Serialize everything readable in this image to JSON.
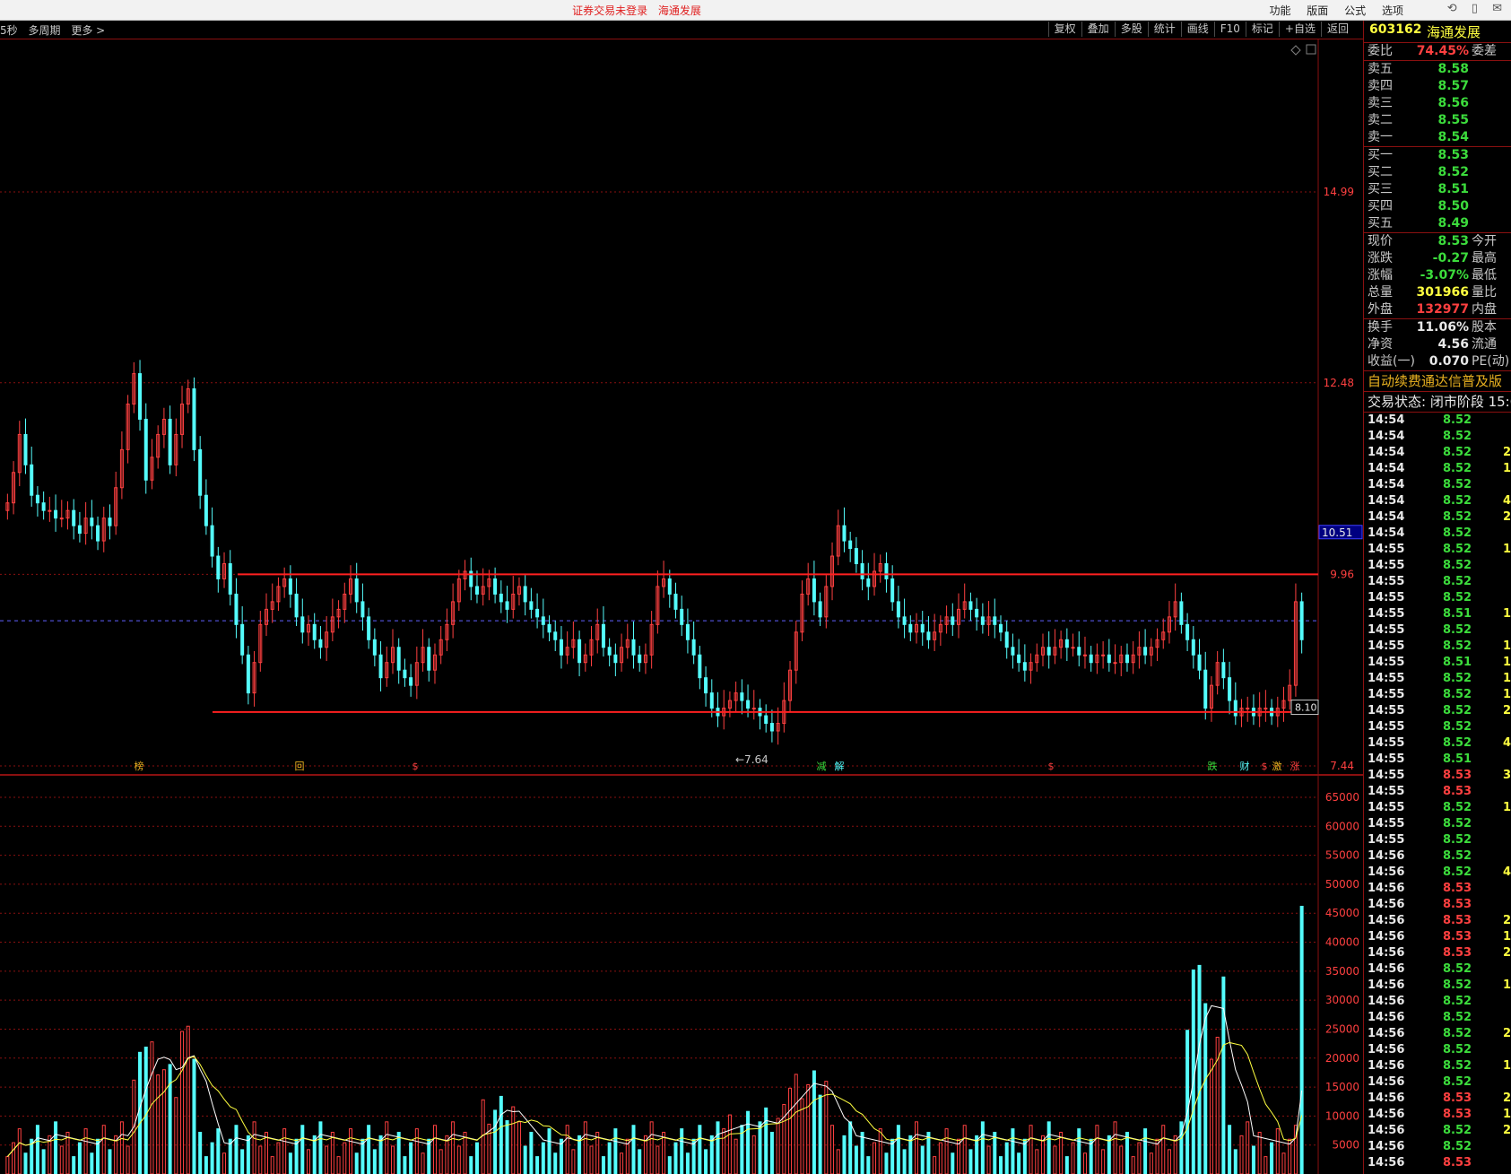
{
  "titlebar": {
    "center": [
      "证券交易未登录",
      "海通发展"
    ],
    "menu": [
      "功能",
      "版面",
      "公式",
      "选项"
    ],
    "controls": [
      "⟲",
      "▯",
      "✉"
    ]
  },
  "toolbar": {
    "left": [
      "5秒",
      "多周期",
      "更多 >"
    ],
    "right": [
      "复权",
      "叠加",
      "多股",
      "统计",
      "画线",
      "F10",
      "标记",
      "+自选",
      "返回"
    ]
  },
  "price_axis": {
    "labels": [
      "14.99",
      "12.48",
      "10.51",
      "9.96",
      "7.44"
    ],
    "current_marker": "10.51",
    "low_label": "←7.64",
    "last_label": "8.10"
  },
  "volume_axis": {
    "labels": [
      "65000",
      "60000",
      "55000",
      "50000",
      "45000",
      "40000",
      "35000",
      "30000",
      "25000",
      "20000",
      "15000",
      "10000",
      "5000"
    ]
  },
  "events": [
    "榜",
    "回",
    "$",
    "减",
    "解",
    "$",
    "跌",
    "财",
    "$",
    "激",
    "涨"
  ],
  "colors": {
    "up": "#ff4040",
    "down": "#54fcfc",
    "grid": "#8a1010",
    "level_line": "#ff2020",
    "ma": "#ffffff",
    "ma2": "#ffff40"
  },
  "quote": {
    "code": "603162",
    "name": "海通发展",
    "weibi": {
      "label": "委比",
      "value": "74.45%",
      "label2": "委差"
    },
    "sells": [
      {
        "label": "卖五",
        "price": "8.58"
      },
      {
        "label": "卖四",
        "price": "8.57"
      },
      {
        "label": "卖三",
        "price": "8.56"
      },
      {
        "label": "卖二",
        "price": "8.55"
      },
      {
        "label": "卖一",
        "price": "8.54"
      }
    ],
    "buys": [
      {
        "label": "买一",
        "price": "8.53"
      },
      {
        "label": "买二",
        "price": "8.52"
      },
      {
        "label": "买三",
        "price": "8.51"
      },
      {
        "label": "买四",
        "price": "8.50"
      },
      {
        "label": "买五",
        "price": "8.49"
      }
    ],
    "stats": [
      {
        "label": "现价",
        "value": "8.53",
        "label2": "今开",
        "color": "green"
      },
      {
        "label": "涨跌",
        "value": "-0.27",
        "label2": "最高",
        "color": "green"
      },
      {
        "label": "涨幅",
        "value": "-3.07%",
        "label2": "最低",
        "color": "green"
      },
      {
        "label": "总量",
        "value": "301966",
        "label2": "量比",
        "color": "yellow"
      },
      {
        "label": "外盘",
        "value": "132977",
        "label2": "内盘",
        "color": "red"
      }
    ],
    "stats2": [
      {
        "label": "换手",
        "value": "11.06%",
        "label2": "股本",
        "color": "white"
      },
      {
        "label": "净资",
        "value": "4.56",
        "label2": "流通",
        "color": "white"
      },
      {
        "label": "收益(一)",
        "value": "0.070",
        "label2": "PE(动)",
        "color": "white"
      }
    ],
    "banner": "自动续费通达信普及版",
    "status": "交易状态: 闭市阶段 15:0"
  },
  "ticks": [
    {
      "time": "14:54",
      "price": "8.52",
      "vol": ""
    },
    {
      "time": "14:54",
      "price": "8.52",
      "vol": ""
    },
    {
      "time": "14:54",
      "price": "8.52",
      "vol": "2"
    },
    {
      "time": "14:54",
      "price": "8.52",
      "vol": "1"
    },
    {
      "time": "14:54",
      "price": "8.52",
      "vol": ""
    },
    {
      "time": "14:54",
      "price": "8.52",
      "vol": "4"
    },
    {
      "time": "14:54",
      "price": "8.52",
      "vol": "2"
    },
    {
      "time": "14:54",
      "price": "8.52",
      "vol": ""
    },
    {
      "time": "14:55",
      "price": "8.52",
      "vol": "1"
    },
    {
      "time": "14:55",
      "price": "8.52",
      "vol": ""
    },
    {
      "time": "14:55",
      "price": "8.52",
      "vol": ""
    },
    {
      "time": "14:55",
      "price": "8.52",
      "vol": ""
    },
    {
      "time": "14:55",
      "price": "8.51",
      "vol": "1"
    },
    {
      "time": "14:55",
      "price": "8.52",
      "vol": ""
    },
    {
      "time": "14:55",
      "price": "8.52",
      "vol": "1"
    },
    {
      "time": "14:55",
      "price": "8.51",
      "vol": "1"
    },
    {
      "time": "14:55",
      "price": "8.52",
      "vol": "1"
    },
    {
      "time": "14:55",
      "price": "8.52",
      "vol": "1"
    },
    {
      "time": "14:55",
      "price": "8.52",
      "vol": "2"
    },
    {
      "time": "14:55",
      "price": "8.52",
      "vol": ""
    },
    {
      "time": "14:55",
      "price": "8.52",
      "vol": "4"
    },
    {
      "time": "14:55",
      "price": "8.51",
      "vol": ""
    },
    {
      "time": "14:55",
      "price": "8.53",
      "vol": "3"
    },
    {
      "time": "14:55",
      "price": "8.53",
      "vol": ""
    },
    {
      "time": "14:55",
      "price": "8.52",
      "vol": "1"
    },
    {
      "time": "14:55",
      "price": "8.52",
      "vol": ""
    },
    {
      "time": "14:55",
      "price": "8.52",
      "vol": ""
    },
    {
      "time": "14:56",
      "price": "8.52",
      "vol": ""
    },
    {
      "time": "14:56",
      "price": "8.52",
      "vol": "4"
    },
    {
      "time": "14:56",
      "price": "8.53",
      "vol": ""
    },
    {
      "time": "14:56",
      "price": "8.53",
      "vol": ""
    },
    {
      "time": "14:56",
      "price": "8.53",
      "vol": "2"
    },
    {
      "time": "14:56",
      "price": "8.53",
      "vol": "1"
    },
    {
      "time": "14:56",
      "price": "8.53",
      "vol": "2"
    },
    {
      "time": "14:56",
      "price": "8.52",
      "vol": ""
    },
    {
      "time": "14:56",
      "price": "8.52",
      "vol": "1"
    },
    {
      "time": "14:56",
      "price": "8.52",
      "vol": ""
    },
    {
      "time": "14:56",
      "price": "8.52",
      "vol": ""
    },
    {
      "time": "14:56",
      "price": "8.52",
      "vol": "2"
    },
    {
      "time": "14:56",
      "price": "8.52",
      "vol": ""
    },
    {
      "time": "14:56",
      "price": "8.52",
      "vol": "1"
    },
    {
      "time": "14:56",
      "price": "8.52",
      "vol": ""
    },
    {
      "time": "14:56",
      "price": "8.53",
      "vol": "2"
    },
    {
      "time": "14:56",
      "price": "8.53",
      "vol": "1"
    },
    {
      "time": "14:56",
      "price": "8.52",
      "vol": "2"
    },
    {
      "time": "14:56",
      "price": "8.52",
      "vol": ""
    },
    {
      "time": "14:56",
      "price": "8.53",
      "vol": ""
    }
  ],
  "chart_data": {
    "type": "candlestick",
    "price_ylim": [
      7.44,
      14.99
    ],
    "price_ticks": [
      7.44,
      9.96,
      12.48,
      14.99
    ],
    "support": 8.15,
    "resistance": 9.96,
    "low_marker": 7.64,
    "closes": [
      10.9,
      11.3,
      11.8,
      11.4,
      11.0,
      10.9,
      10.8,
      10.8,
      10.7,
      10.7,
      10.8,
      10.6,
      10.5,
      10.7,
      10.6,
      10.4,
      10.7,
      10.6,
      11.1,
      11.6,
      12.2,
      12.6,
      12.0,
      11.2,
      11.5,
      11.8,
      12.0,
      11.4,
      11.8,
      12.2,
      12.4,
      11.6,
      11.0,
      10.6,
      10.2,
      9.9,
      10.1,
      9.7,
      9.3,
      8.9,
      8.4,
      8.8,
      9.3,
      9.5,
      9.6,
      9.8,
      9.9,
      9.7,
      9.4,
      9.2,
      9.3,
      9.1,
      9.0,
      9.2,
      9.4,
      9.5,
      9.7,
      9.9,
      9.6,
      9.4,
      9.1,
      8.9,
      8.6,
      8.8,
      9.0,
      8.7,
      8.6,
      8.5,
      8.8,
      9.0,
      8.7,
      8.9,
      9.1,
      9.3,
      9.6,
      9.9,
      10.0,
      9.8,
      9.7,
      9.8,
      9.9,
      9.7,
      9.6,
      9.5,
      9.7,
      9.8,
      9.6,
      9.5,
      9.4,
      9.3,
      9.2,
      9.1,
      8.9,
      9.0,
      9.1,
      8.8,
      8.9,
      9.1,
      9.3,
      9.0,
      8.9,
      8.8,
      9.0,
      9.1,
      8.9,
      8.8,
      8.9,
      9.3,
      9.8,
      9.9,
      9.7,
      9.5,
      9.3,
      9.1,
      8.9,
      8.6,
      8.4,
      8.2,
      8.1,
      8.2,
      8.3,
      8.4,
      8.3,
      8.2,
      8.2,
      8.1,
      8.0,
      7.9,
      8.0,
      8.3,
      8.7,
      9.2,
      9.7,
      9.9,
      9.6,
      9.4,
      9.8,
      10.2,
      10.6,
      10.4,
      10.3,
      10.1,
      9.9,
      9.8,
      10.0,
      10.1,
      9.9,
      9.6,
      9.4,
      9.3,
      9.2,
      9.3,
      9.2,
      9.1,
      9.2,
      9.3,
      9.4,
      9.3,
      9.5,
      9.6,
      9.5,
      9.4,
      9.3,
      9.4,
      9.3,
      9.2,
      9.0,
      8.9,
      8.8,
      8.7,
      8.8,
      8.9,
      9.0,
      8.9,
      9.0,
      9.1,
      9.0,
      9.0,
      8.9,
      8.9,
      8.8,
      8.9,
      8.9,
      8.8,
      8.8,
      8.9,
      8.8,
      8.9,
      9.0,
      8.9,
      9.0,
      9.1,
      9.2,
      9.4,
      9.6,
      9.3,
      9.1,
      8.9,
      8.7,
      8.2,
      8.5,
      8.8,
      8.6,
      8.3,
      8.1,
      8.2,
      8.2,
      8.1,
      8.2,
      8.2,
      8.1,
      8.2,
      8.3,
      8.5,
      9.6,
      9.1
    ],
    "volume_ylim": [
      0,
      65000
    ],
    "volume_ticks": [
      5000,
      10000,
      15000,
      20000,
      25000,
      30000,
      35000,
      40000,
      45000,
      50000,
      55000,
      60000,
      65000
    ]
  }
}
